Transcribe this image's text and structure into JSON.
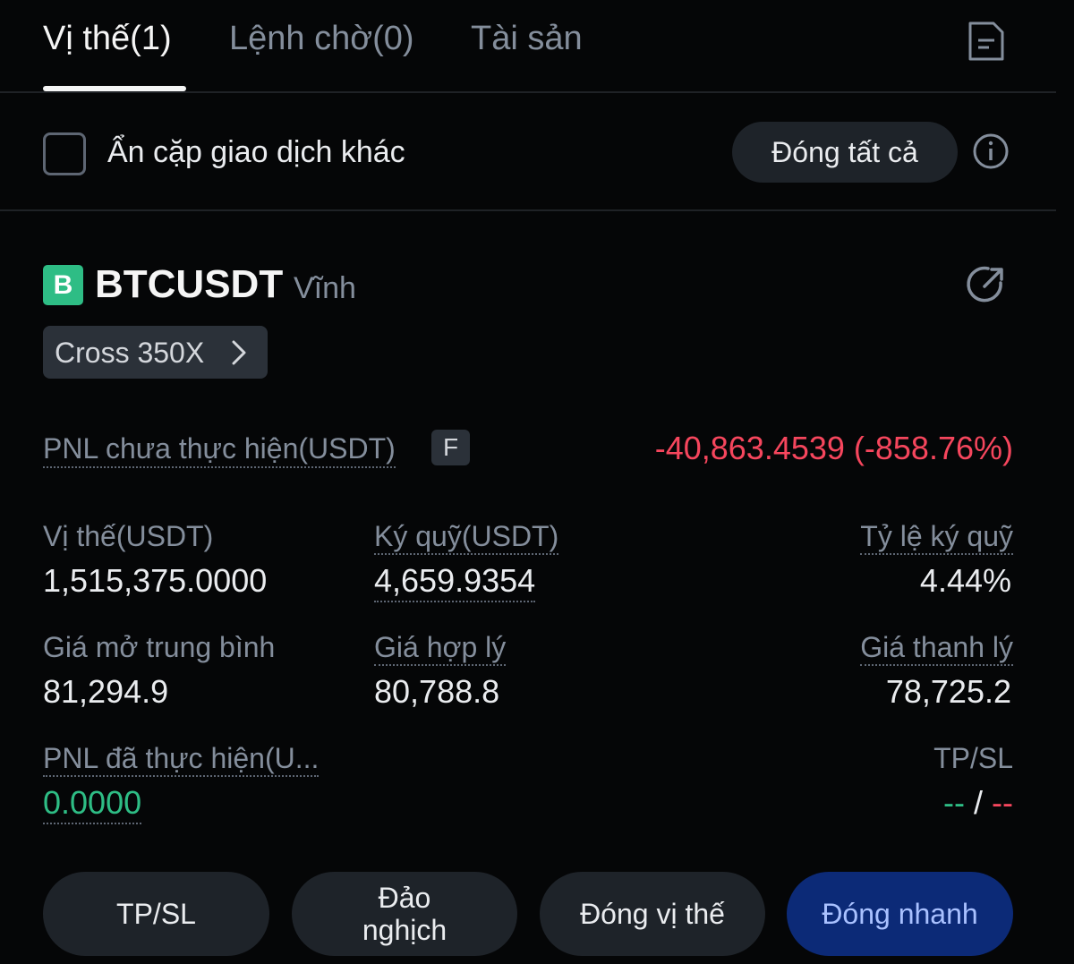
{
  "tabs": [
    {
      "label": "Vị thế(1)",
      "active": true
    },
    {
      "label": "Lệnh chờ(0)",
      "active": false
    },
    {
      "label": "Tài sản",
      "active": false
    }
  ],
  "filter": {
    "hide_other_pairs_label": "Ẩn cặp giao dịch khác",
    "hide_other_pairs_checked": false,
    "close_all_label": "Đóng tất cả"
  },
  "position": {
    "side_badge": "B",
    "symbol": "BTCUSDT",
    "contract_type": "Vĩnh",
    "margin_mode": "Cross 350X",
    "unrealized_pnl_label": "PNL chưa thực hiện(USDT)",
    "unrealized_pnl_badge": "F",
    "unrealized_pnl_value": "-40,863.4539 (-858.76%)",
    "size_label": "Vị thế(USDT)",
    "size_value": "1,515,375.0000",
    "margin_label": "Ký quỹ(USDT)",
    "margin_value": "4,659.9354",
    "margin_ratio_label": "Tỷ lệ ký quỹ",
    "margin_ratio_value": "4.44%",
    "entry_price_label": "Giá mở trung bình",
    "entry_price_value": "81,294.9",
    "mark_price_label": "Giá hợp lý",
    "mark_price_value": "80,788.8",
    "liq_price_label": "Giá thanh lý",
    "liq_price_value": "78,725.2",
    "realized_pnl_label": "PNL đã thực hiện(U...",
    "realized_pnl_value": "0.0000",
    "tpsl_label": "TP/SL",
    "tp_value": "--",
    "tpsl_separator": "/",
    "sl_value": "--"
  },
  "actions": {
    "tpsl": "TP/SL",
    "reverse_line1": "Đảo",
    "reverse_line2": "nghịch",
    "close_position": "Đóng vị thế",
    "quick_close": "Đóng nhanh"
  },
  "colors": {
    "background": "#050607",
    "positive": "#2ebd85",
    "negative": "#f6465d",
    "primary_button": "#0c2a77"
  }
}
